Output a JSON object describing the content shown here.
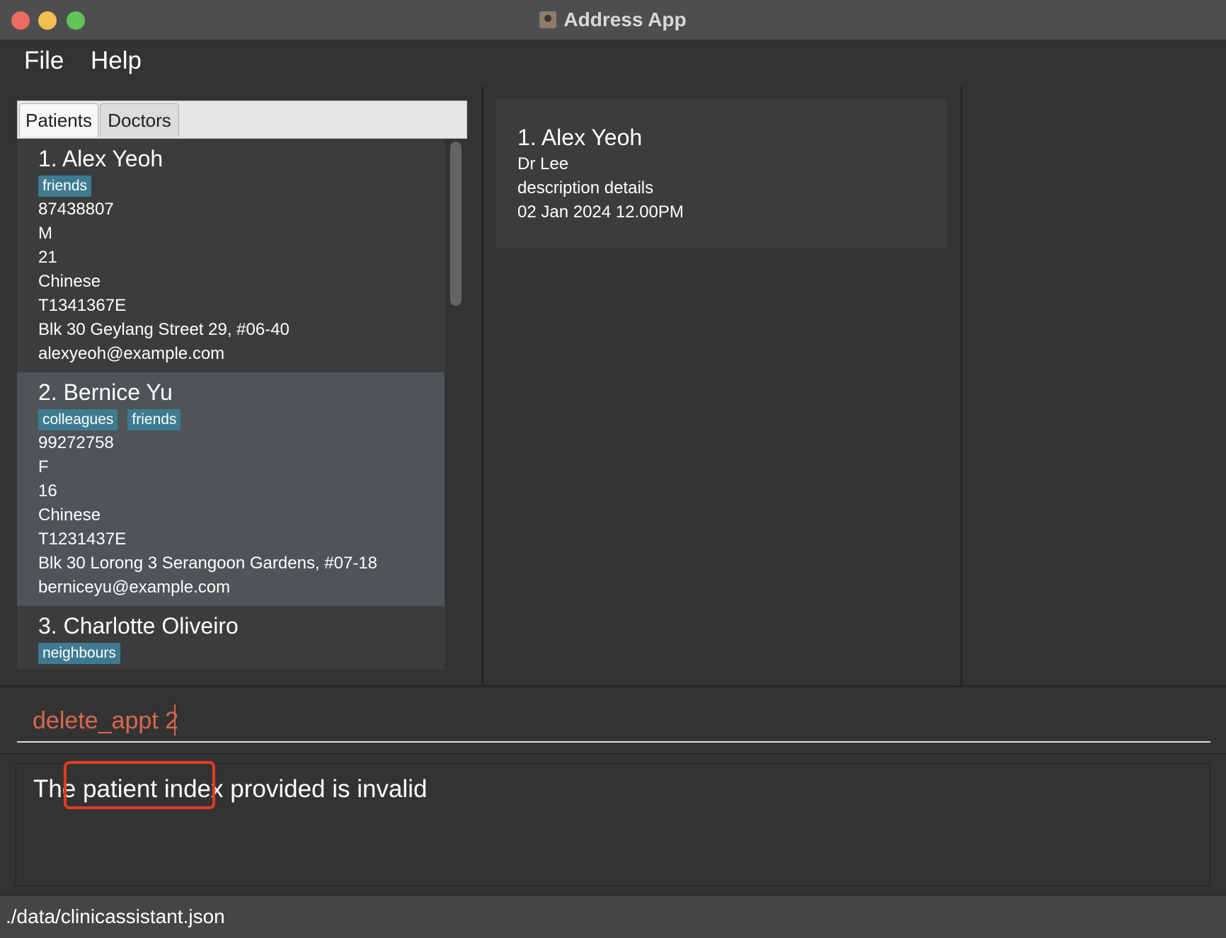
{
  "window": {
    "title": "Address App",
    "icon": "address-book-icon"
  },
  "menu": {
    "items": [
      "File",
      "Help"
    ]
  },
  "tabs": {
    "items": [
      "Patients",
      "Doctors"
    ],
    "active": "Patients"
  },
  "patients": [
    {
      "title": "1.  Alex Yeoh",
      "tags": [
        "friends"
      ],
      "phone": "87438807",
      "gender": "M",
      "age": "21",
      "race": "Chinese",
      "nric": "T1341367E",
      "address": "Blk 30 Geylang Street 29, #06-40",
      "email": "alexyeoh@example.com"
    },
    {
      "title": "2.  Bernice Yu",
      "tags": [
        "colleagues",
        "friends"
      ],
      "phone": "99272758",
      "gender": "F",
      "age": "16",
      "race": "Chinese",
      "nric": "T1231437E",
      "address": "Blk 30 Lorong 3 Serangoon Gardens, #07-18",
      "email": "berniceyu@example.com"
    },
    {
      "title": "3.  Charlotte Oliveiro",
      "tags": [
        "neighbours"
      ]
    }
  ],
  "appointments": [
    {
      "title": "1.  Alex Yeoh",
      "doctor": "Dr Lee",
      "description": "description details",
      "datetime": "02 Jan 2024 12.00PM"
    }
  ],
  "command": {
    "value": "delete_appt 2"
  },
  "result": {
    "message": "The patient index provided is invalid"
  },
  "status": {
    "file_path": "./data/clinicassistant.json"
  },
  "colors": {
    "tag": "#3e7b91",
    "command_text": "#d7674f",
    "highlight": "#e33b22",
    "selected_card": "#4f5457"
  }
}
